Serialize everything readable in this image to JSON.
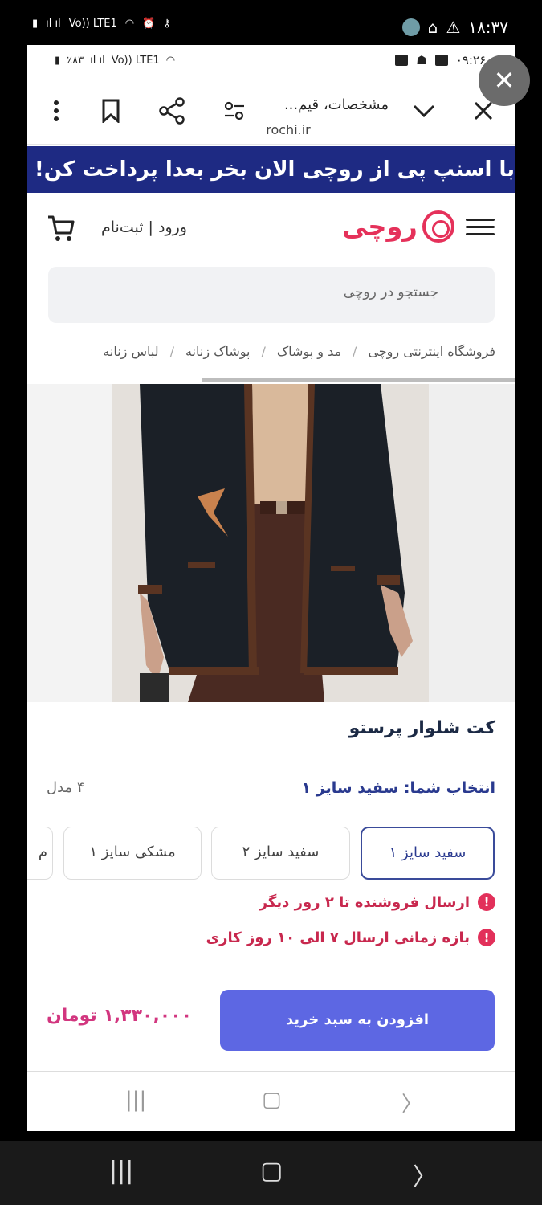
{
  "outer_status": {
    "left_label": "Vo)) LTE1",
    "time": "۱۸:۳۷"
  },
  "inner_status": {
    "battery": "٪۸۳",
    "network": "Vo)) LTE1",
    "time": "۰۹:۲۶"
  },
  "browser": {
    "title": "مشخصات، قیم...",
    "url": "rochi.ir"
  },
  "promo_text": "با اسنپ پی از روچی الان بخر بعدا پرداخت کن!",
  "header": {
    "logo_text": "روچی",
    "login_text": "ورود | ثبت‌نام"
  },
  "search": {
    "placeholder": "جستجو در روچی"
  },
  "breadcrumb": [
    "فروشگاه اینترنتی روچی",
    "مد و پوشاک",
    "پوشاک زنانه",
    "لباس زنانه"
  ],
  "product": {
    "title": "کت شلوار پرستو",
    "selection_label": "انتخاب شما: سفید سایز ۱",
    "model_count": "۴ مدل",
    "variants": [
      "سفید سایز ۱",
      "سفید سایز ۲",
      "مشکی سایز ۱",
      "م"
    ],
    "seller_shipping": "ارسال فروشنده تا ۲ روز دیگر",
    "shipping_window": "بازه زمانی ارسال ۷ الی ۱۰ روز کاری",
    "add_to_cart": "افزودن به سبد خرید",
    "price": "۱,۳۳۰,۰۰۰ تومان"
  },
  "colors": {
    "promo_bg": "#1e2a83",
    "brand": "#e5315a",
    "button": "#5d67e3",
    "price": "#d2367f"
  }
}
